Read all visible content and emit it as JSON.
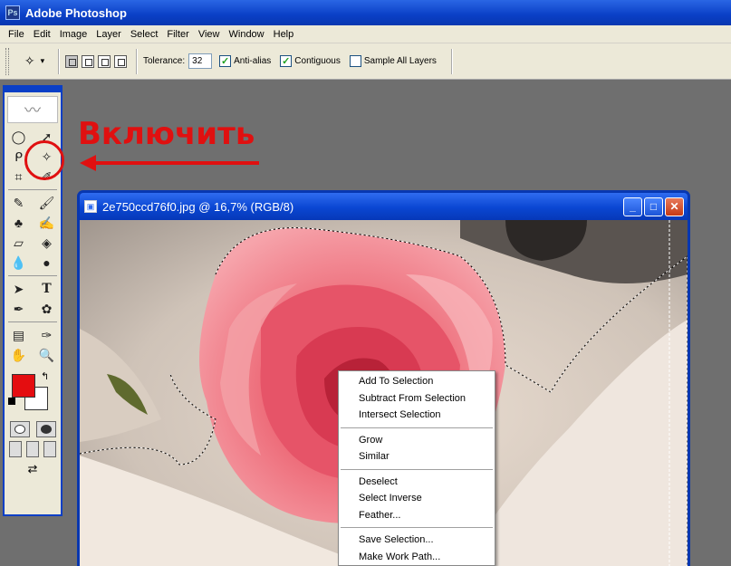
{
  "app": {
    "title": "Adobe Photoshop",
    "logo_text": "Ps"
  },
  "menu": [
    "File",
    "Edit",
    "Image",
    "Layer",
    "Select",
    "Filter",
    "View",
    "Window",
    "Help"
  ],
  "options": {
    "tolerance_label": "Tolerance:",
    "tolerance_value": "32",
    "anti_alias_label": "Anti-alias",
    "anti_alias_checked": true,
    "contiguous_label": "Contiguous",
    "contiguous_checked": true,
    "sample_all_layers_label": "Sample All Layers",
    "sample_all_layers_checked": false
  },
  "annotation": {
    "text": "Включить",
    "color": "#e01010"
  },
  "toolbox": {
    "foreground_color": "#e40d10",
    "background_color": "#ffffff",
    "highlighted_tool": "magic-wand-icon"
  },
  "document": {
    "title": "2e750ccd76f0.jpg @ 16,7% (RGB/8)",
    "buttons": {
      "minimize": "_",
      "maximize": "□",
      "close": "✕"
    }
  },
  "context_menu": {
    "groups": [
      [
        "Add To Selection",
        "Subtract From Selection",
        "Intersect Selection"
      ],
      [
        "Grow",
        "Similar"
      ],
      [
        "Deselect",
        "Select Inverse",
        "Feather..."
      ],
      [
        "Save Selection...",
        "Make Work Path..."
      ]
    ]
  },
  "colors": {
    "titlebar": "#0a3fc6",
    "chrome": "#ece9d8",
    "workspace": "#6f6f6f"
  }
}
